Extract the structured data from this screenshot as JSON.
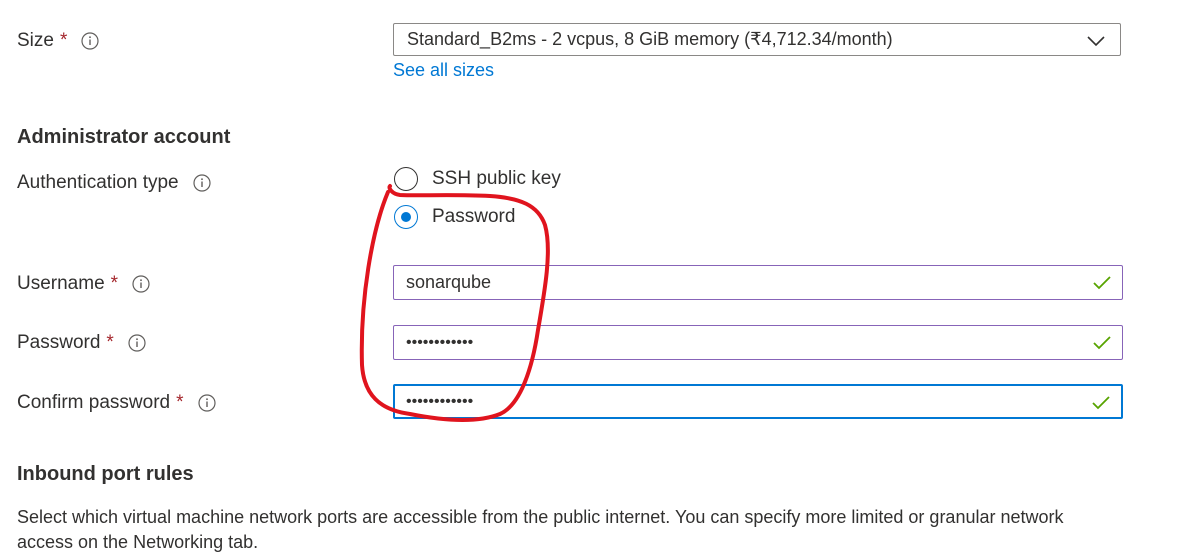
{
  "size": {
    "label": "Size",
    "required_mark": "*",
    "dropdown_value": "Standard_B2ms - 2 vcpus, 8 GiB memory (₹4,712.34/month)",
    "see_all_link": "See all sizes"
  },
  "admin": {
    "section_title": "Administrator account",
    "auth_type_label": "Authentication type",
    "auth_options": [
      {
        "label": "SSH public key",
        "selected": false
      },
      {
        "label": "Password",
        "selected": true
      }
    ],
    "username_label": "Username",
    "username_value": "sonarqube",
    "password_label": "Password",
    "password_value": "••••••••••••",
    "confirm_label": "Confirm password",
    "confirm_value": "••••••••••••",
    "required_mark": "*"
  },
  "inbound": {
    "section_title": "Inbound port rules",
    "description": "Select which virtual machine network ports are accessible from the public internet. You can specify more limited or granular network access on the Networking tab."
  },
  "colors": {
    "accent": "#0078d4",
    "required": "#a4262c",
    "valid_check": "#57a300",
    "annotation": "#e0141e"
  },
  "icons": {
    "info": "info-icon",
    "chevron": "chevron-down-icon",
    "check": "checkmark-icon"
  }
}
